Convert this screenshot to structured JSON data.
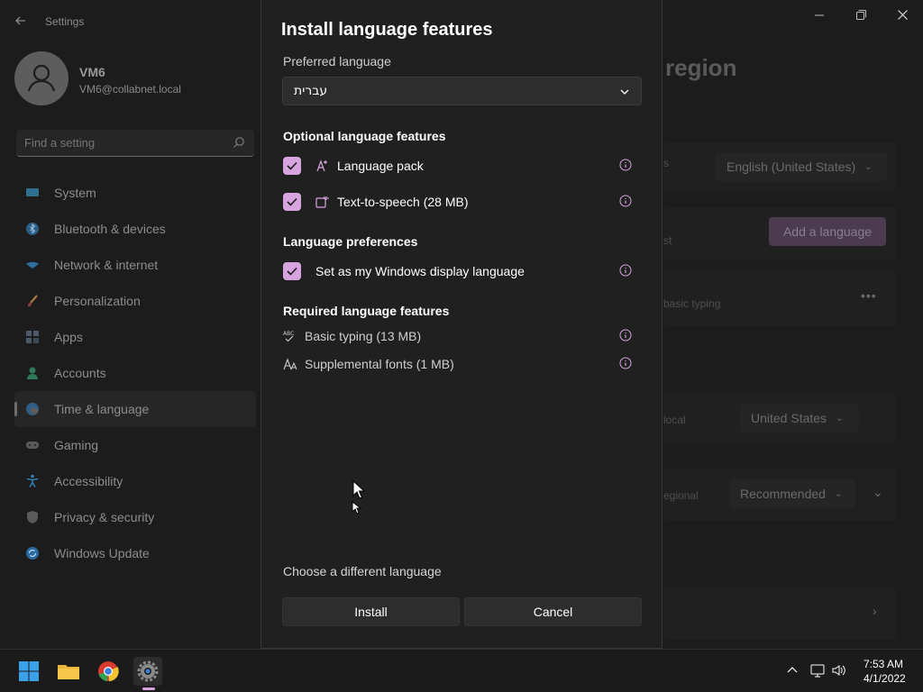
{
  "settings": {
    "app_title": "Settings",
    "user": {
      "name": "VM6",
      "email": "VM6@collabnet.local"
    },
    "search_placeholder": "Find a setting",
    "nav": [
      {
        "label": "System",
        "icon": "monitor-icon"
      },
      {
        "label": "Bluetooth & devices",
        "icon": "bluetooth-icon"
      },
      {
        "label": "Network & internet",
        "icon": "wifi-icon"
      },
      {
        "label": "Personalization",
        "icon": "brush-icon"
      },
      {
        "label": "Apps",
        "icon": "apps-icon"
      },
      {
        "label": "Accounts",
        "icon": "person-icon"
      },
      {
        "label": "Time & language",
        "icon": "globe-clock-icon",
        "active": true
      },
      {
        "label": "Gaming",
        "icon": "gamepad-icon"
      },
      {
        "label": "Accessibility",
        "icon": "accessibility-icon"
      },
      {
        "label": "Privacy & security",
        "icon": "shield-icon"
      },
      {
        "label": "Windows Update",
        "icon": "update-icon"
      }
    ],
    "page_title_fragment": "region",
    "background": {
      "row1_text": "s",
      "row1_value": "English (United States)",
      "row2_text": "st",
      "add_language_label": "Add a language",
      "row3_text": "basic typing",
      "row4_text": "local",
      "row4_value": "United States",
      "row5_text": "egional",
      "row5_value": "Recommended"
    }
  },
  "dialog": {
    "title": "Install language features",
    "preferred_label": "Preferred language",
    "preferred_value": "עברית",
    "optional_header": "Optional language features",
    "optional": [
      {
        "label": "Language pack",
        "checked": true,
        "icon": "language-pack-icon"
      },
      {
        "label": "Text-to-speech (28 MB)",
        "checked": true,
        "icon": "text-to-speech-icon"
      }
    ],
    "preferences_header": "Language preferences",
    "preferences": [
      {
        "label": "Set as my Windows display language",
        "checked": true
      }
    ],
    "required_header": "Required language features",
    "required": [
      {
        "label": "Basic typing (13 MB)",
        "icon": "spellcheck-icon"
      },
      {
        "label": "Supplemental fonts (1 MB)",
        "icon": "font-icon"
      }
    ],
    "different_link": "Choose a different language",
    "install_label": "Install",
    "cancel_label": "Cancel"
  },
  "taskbar": {
    "apps": [
      "start-icon",
      "file-explorer-icon",
      "chrome-icon",
      "settings-icon"
    ],
    "time": "7:53 AM",
    "date": "4/1/2022"
  },
  "colors": {
    "accent": "#d8a4e0",
    "dialog_bg": "#202020",
    "background": "#1c1c1c"
  }
}
